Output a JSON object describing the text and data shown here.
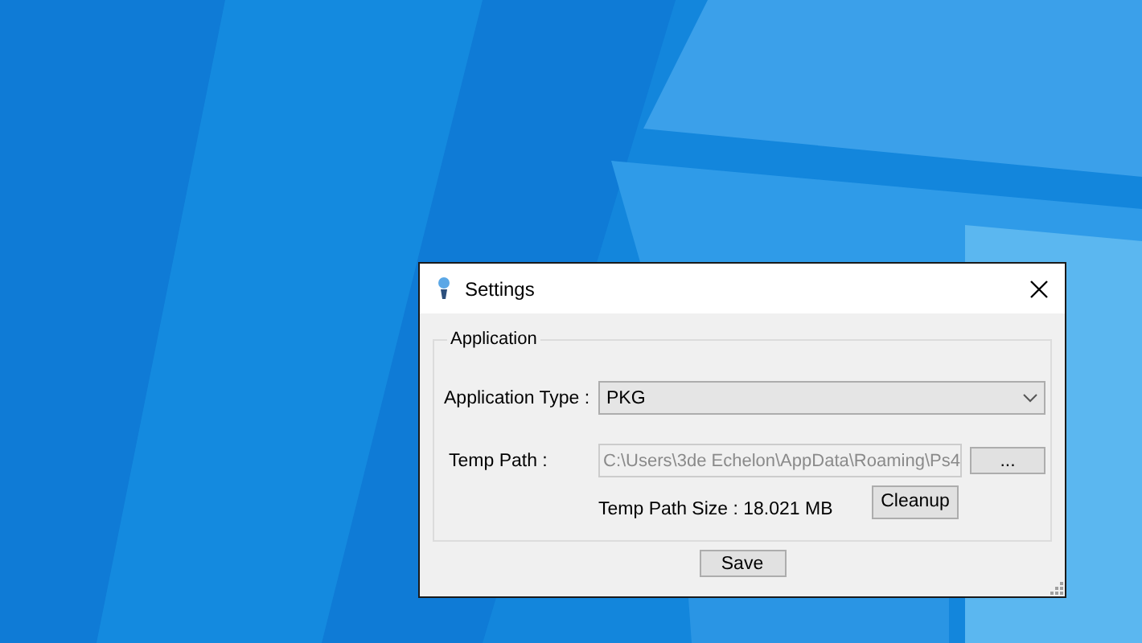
{
  "window": {
    "title": "Settings"
  },
  "group": {
    "title": "Application"
  },
  "application_type": {
    "label": "Application Type :",
    "value": "PKG"
  },
  "temp_path": {
    "label": "Temp Path :",
    "value": "C:\\Users\\3de Echelon\\AppData\\Roaming\\Ps4",
    "disabled": true,
    "browse_button": "..."
  },
  "temp_path_size": "Temp Path Size : 18.021 MB",
  "cleanup_button": "Cleanup",
  "save_button": "Save"
}
